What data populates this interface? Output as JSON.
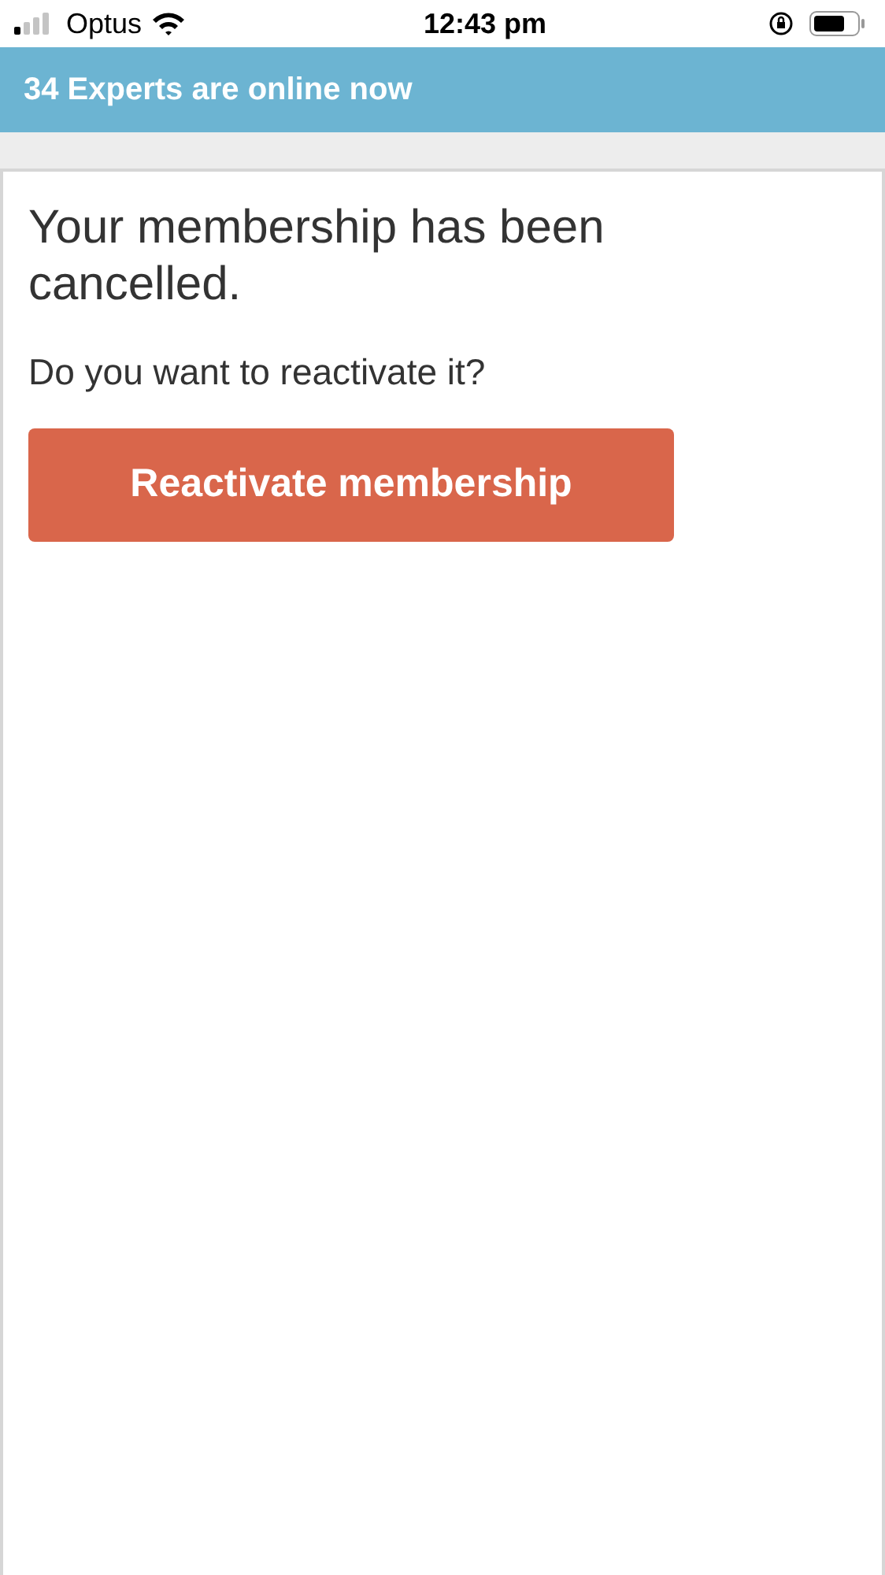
{
  "status_bar": {
    "carrier": "Optus",
    "time": "12:43 pm"
  },
  "banner": {
    "text": "34 Experts are online now"
  },
  "card": {
    "heading": "Your membership has been cancelled.",
    "question": "Do you want to reactivate it?",
    "button": "Reactivate membership"
  }
}
